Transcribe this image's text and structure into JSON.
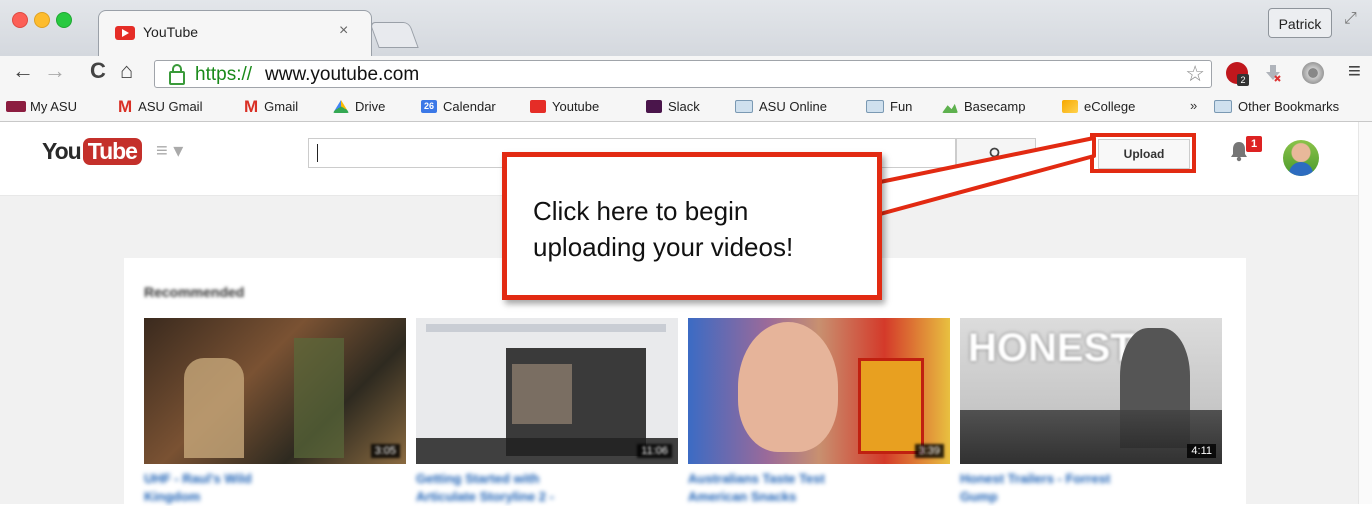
{
  "browser": {
    "tab_title": "YouTube",
    "tab_close": "×",
    "profile": "Patrick",
    "url_scheme": "https://",
    "url_rest": "www.youtube.com",
    "nav": {
      "back": "←",
      "forward": "→",
      "reload": "C",
      "home": "⌂"
    }
  },
  "bookmarks": [
    {
      "label": "My ASU",
      "icon": "asu-icon"
    },
    {
      "label": "ASU Gmail",
      "icon": "gmail-icon"
    },
    {
      "label": "Gmail",
      "icon": "gmail-icon"
    },
    {
      "label": "Drive",
      "icon": "drive-icon"
    },
    {
      "label": "Calendar",
      "icon": "calendar-icon",
      "icon_text": "26"
    },
    {
      "label": "Youtube",
      "icon": "youtube-icon"
    },
    {
      "label": "Slack",
      "icon": "slack-icon"
    },
    {
      "label": "ASU Online",
      "icon": "folder-icon"
    },
    {
      "label": "Fun",
      "icon": "folder-icon"
    },
    {
      "label": "Basecamp",
      "icon": "basecamp-icon"
    },
    {
      "label": "eCollege",
      "icon": "ecollege-icon"
    }
  ],
  "bookmarks_more": "»",
  "other_bookmarks": "Other Bookmarks",
  "youtube": {
    "logo_you": "You",
    "logo_tube": "Tube",
    "guide": "≡ ▾",
    "search_icon": "⚲",
    "upload_label": "Upload",
    "notification_count": "1",
    "section_title": "Recommended",
    "videos": [
      {
        "title": "UHF - Raul's Wild",
        "title2": "Kingdom",
        "duration": "3:05"
      },
      {
        "title": "Getting Started with",
        "title2": "Articulate Storyline 2 -",
        "duration": "11:06"
      },
      {
        "title": "Australians Taste Test",
        "title2": "American Snacks",
        "duration": "3:39"
      },
      {
        "title": "Honest Trailers - Forrest",
        "title2": "Gump",
        "duration": "4:11"
      }
    ]
  },
  "callout": {
    "line1": "Click here to begin",
    "line2": "uploading your videos!"
  },
  "colors": {
    "annotation_red": "#e22a12",
    "youtube_red": "#c4302b"
  }
}
